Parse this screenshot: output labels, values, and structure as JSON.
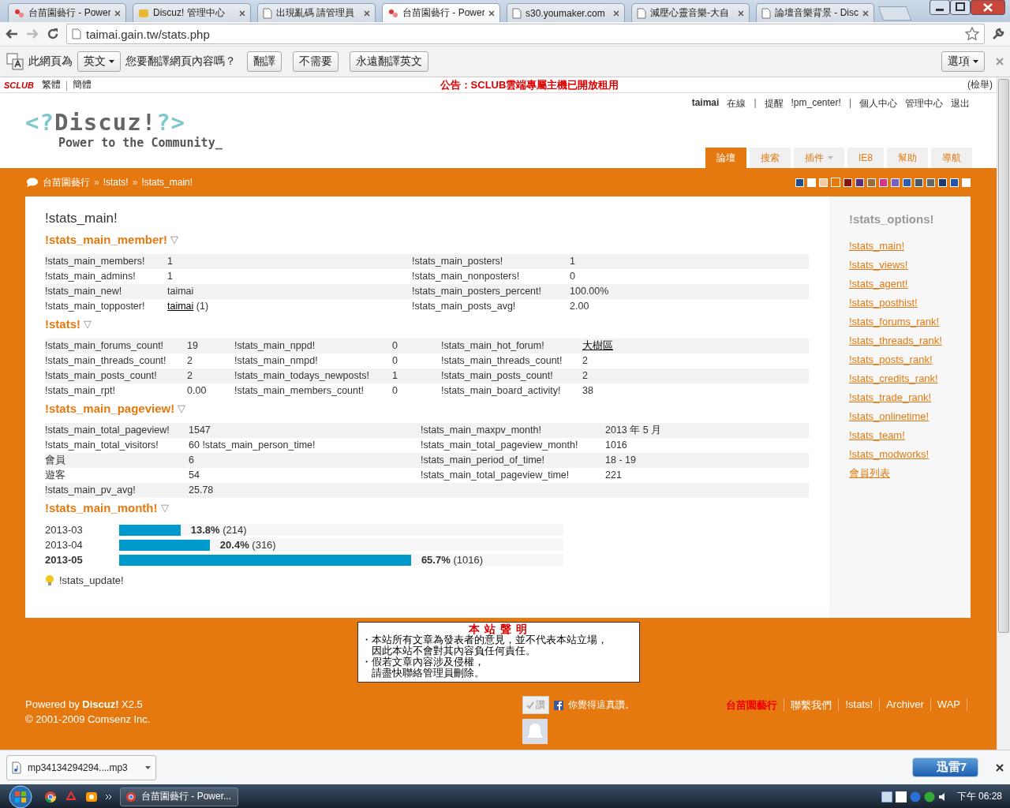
{
  "browser": {
    "tabs": [
      {
        "title": "台苗園藝行 - Power",
        "kind": "leaf",
        "selected": false
      },
      {
        "title": "Discuz! 管理中心",
        "kind": "badge",
        "selected": false
      },
      {
        "title": "出現亂碼 請管理員",
        "kind": "page",
        "selected": false
      },
      {
        "title": "台苗園藝行 - Power",
        "kind": "leaf",
        "selected": true
      },
      {
        "title": "s30.youmaker.com",
        "kind": "page",
        "selected": false
      },
      {
        "title": "減壓心靈音樂-大自",
        "kind": "page",
        "selected": false
      },
      {
        "title": "論壇音樂背景 - Disc",
        "kind": "page",
        "selected": false
      }
    ],
    "address": "taimai.gain.tw/stats.php",
    "translate_bar": {
      "prefix": "此網頁為",
      "language": "英文",
      "question": "您要翻譯網頁內容嗎？",
      "buttons": [
        "翻譯",
        "不需要",
        "永遠翻譯英文"
      ],
      "options": "選項"
    }
  },
  "top_bar": {
    "logo": "SCLUB",
    "languages": [
      {
        "text": "繁體",
        "kind": "link"
      },
      {
        "text": "|",
        "kind": "sep"
      },
      {
        "text": "簡體",
        "kind": "link"
      }
    ],
    "announcement": "公告：SCLUB雲端專屬主機已開放租用",
    "report": "(檢舉)"
  },
  "user_bar": [
    {
      "text": "taimai",
      "kind": "user"
    },
    {
      "text": "在線",
      "kind": "link"
    },
    {
      "text": "|",
      "kind": "sep"
    },
    {
      "text": "提醒",
      "kind": "link"
    },
    {
      "text": "!pm_center!",
      "kind": "link"
    },
    {
      "text": "|",
      "kind": "sep"
    },
    {
      "text": "個人中心",
      "kind": "link"
    },
    {
      "text": "管理中心",
      "kind": "link"
    },
    {
      "text": "退出",
      "kind": "link"
    }
  ],
  "logo": {
    "parts": [
      "<?",
      "Discuz!",
      "?>"
    ],
    "tagline": "Power to the Community_"
  },
  "nav": [
    {
      "label": "論壇",
      "selected": true
    },
    {
      "label": "搜索",
      "selected": false
    },
    {
      "label": "插件",
      "selected": false,
      "menu": true
    },
    {
      "label": "IE8",
      "selected": false
    },
    {
      "label": "幫助",
      "selected": false
    },
    {
      "label": "導航",
      "selected": false
    }
  ],
  "breadcrumb": [
    {
      "text": "台苗園藝行",
      "kind": "link"
    },
    {
      "text": "»",
      "kind": "sep"
    },
    {
      "text": "!stats!",
      "kind": "link"
    },
    {
      "text": "»",
      "kind": "sep"
    },
    {
      "text": "!stats_main!",
      "kind": "current"
    }
  ],
  "styles": [
    {
      "color": "#1f4f8f",
      "selected": false
    },
    {
      "color": "#ffffff",
      "selected": false
    },
    {
      "color": "#f3c9a0",
      "selected": false
    },
    {
      "color": "#e5790f",
      "selected": true
    },
    {
      "color": "#8b1010",
      "selected": false
    },
    {
      "color": "#5a2d82",
      "selected": false
    },
    {
      "color": "#9a6b3c",
      "selected": false
    },
    {
      "color": "#d6338a",
      "selected": false
    },
    {
      "color": "#7a5fc0",
      "selected": false
    },
    {
      "color": "#2a5db0",
      "selected": false
    },
    {
      "color": "#4b5a6a",
      "selected": false
    },
    {
      "color": "#666666",
      "selected": false
    },
    {
      "color": "#1a3c6e",
      "selected": false
    },
    {
      "color": "#2255aa",
      "selected": false
    },
    {
      "color": "#fffffe",
      "selected": false
    }
  ],
  "main": {
    "title": "!stats_main!",
    "sections": [
      {
        "title": "!stats_main_member!",
        "toggle": "▽",
        "kind": "table",
        "rows": [
          [
            "!stats_main_members!",
            "1",
            "!stats_main_posters!",
            "1"
          ],
          [
            "!stats_main_admins!",
            "1",
            "!stats_main_nonposters!",
            "0"
          ],
          [
            "!stats_main_new!",
            "taimai",
            "!stats_main_posters_percent!",
            "100.00%"
          ],
          [
            "!stats_main_topposter!",
            {
              "link": "taimai",
              "after": "(1)"
            },
            "!stats_main_posts_avg!",
            "2.00"
          ]
        ]
      },
      {
        "title": "!stats!",
        "toggle": "▽",
        "kind": "table",
        "rows": [
          [
            "!stats_main_forums_count!",
            "19",
            "!stats_main_nppd!",
            "0",
            "!stats_main_hot_forum!",
            {
              "link": "大樹區"
            }
          ],
          [
            "!stats_main_threads_count!",
            "2",
            "!stats_main_nmpd!",
            "0",
            "!stats_main_threads_count!",
            "2"
          ],
          [
            "!stats_main_posts_count!",
            "2",
            "!stats_main_todays_newposts!",
            "1",
            "!stats_main_posts_count!",
            "2"
          ],
          [
            "!stats_main_rpt!",
            "0.00",
            "!stats_main_members_count!",
            "0",
            "!stats_main_board_activity!",
            "38"
          ]
        ]
      },
      {
        "title": "!stats_main_pageview!",
        "toggle": "▽",
        "kind": "table",
        "rows": [
          [
            "!stats_main_total_pageview!",
            "1547",
            "!stats_main_maxpv_month!",
            "2013 年 5 月"
          ],
          [
            "!stats_main_total_visitors!",
            "60 !stats_main_person_time!",
            "!stats_main_total_pageview_month!",
            "1016"
          ],
          [
            "會員",
            "6",
            "!stats_main_period_of_time!",
            "18 - 19"
          ],
          [
            "遊客",
            "54",
            "!stats_main_total_pageview_time!",
            "221"
          ],
          [
            "!stats_main_pv_avg!",
            "25.78"
          ]
        ]
      },
      {
        "title": "!stats_main_month!",
        "toggle": "▽",
        "kind": "bars",
        "rows": [
          {
            "month": "2013-03",
            "level": 0.138,
            "label": "**13.8%** (214)",
            "current": false
          },
          {
            "month": "2013-04",
            "level": 0.204,
            "label": "**20.4%** (316)",
            "current": false
          },
          {
            "month": "2013-05",
            "level": 0.657,
            "label": "**65.7%** (1016)",
            "current": true
          }
        ]
      }
    ],
    "update": "!stats_update!"
  },
  "sidebar": {
    "title": "!stats_options!",
    "links": [
      "!stats_main!",
      "!stats_views!",
      "!stats_agent!",
      "!stats_posthist!",
      "!stats_forums_rank!",
      "!stats_threads_rank!",
      "!stats_posts_rank!",
      "!stats_credits_rank!",
      "!stats_trade_rank!",
      "!stats_onlinetime!",
      "!stats_team!",
      "!stats_modworks!",
      "會員列表"
    ]
  },
  "notice": {
    "title": "本 站 聲 明",
    "lines": [
      "・本站所有文章為發表者的意見，並不代表本站立場，",
      "　因此本站不會對其內容負任何責任。",
      "・假若文章內容涉及侵權，",
      "　請盡快聯絡管理員刪除。"
    ]
  },
  "footer": {
    "powered": "Powered by **Discuz!** X2.5",
    "copyright": "© 2001-2009 Comsenz Inc.",
    "links": [
      {
        "text": "台苗園藝行",
        "kind": "home"
      },
      {
        "text": "聯繫我們",
        "kind": "link"
      },
      {
        "text": "!stats!",
        "kind": "link"
      },
      {
        "text": "Archiver",
        "kind": "link"
      },
      {
        "text": "WAP",
        "kind": "link"
      }
    ],
    "like_button": "讚",
    "like_text": "你覺得這真讚。"
  },
  "download_bar": {
    "file": "mp34134294294....mp3",
    "badge": "迅雷7"
  },
  "taskbar": {
    "task": "台苗園藝行 - Power...",
    "clock": "下午 06:28"
  }
}
